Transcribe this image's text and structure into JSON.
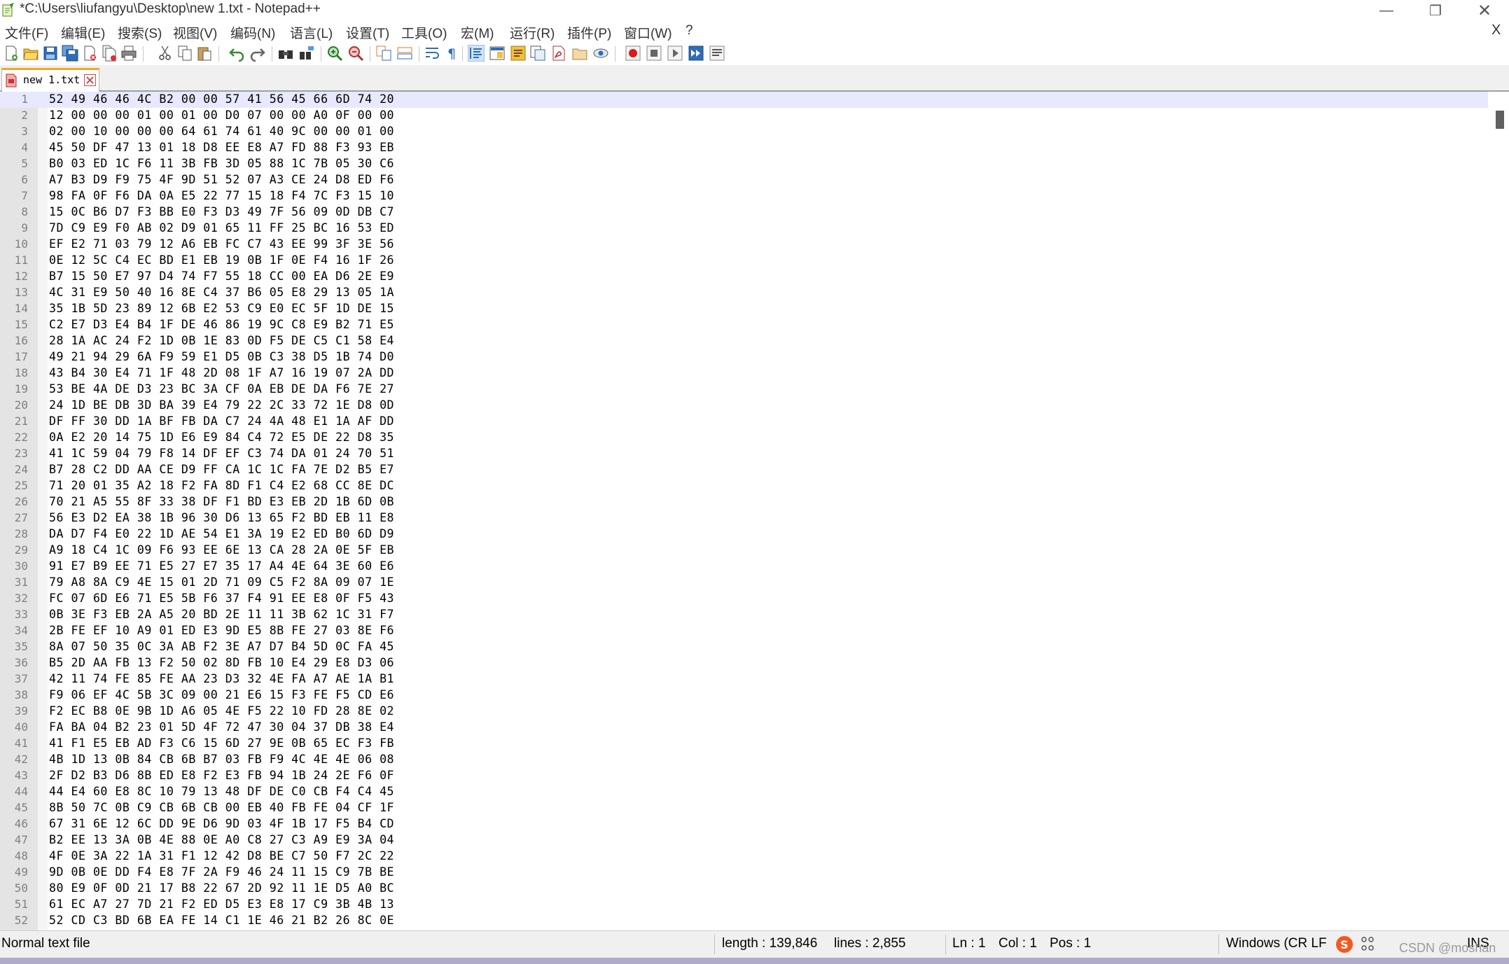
{
  "window": {
    "title": "*C:\\Users\\liufangyu\\Desktop\\new 1.txt - Notepad++",
    "minimize_glyph": "—",
    "maximize_glyph": "❐",
    "close_glyph": "✕"
  },
  "menu": {
    "items": [
      "文件(F)",
      "编辑(E)",
      "搜索(S)",
      "视图(V)",
      "编码(N)",
      "语言(L)",
      "设置(T)",
      "工具(O)",
      "宏(M)",
      "运行(R)",
      "插件(P)",
      "窗口(W)",
      "?"
    ],
    "close_label": "X"
  },
  "toolbar": {
    "icons": [
      "new-file-icon",
      "open-file-icon",
      "save-icon",
      "save-all-icon",
      "close-icon",
      "close-all-icon",
      "print-icon",
      "cut-icon",
      "copy-icon",
      "paste-icon",
      "undo-icon",
      "redo-icon",
      "find-icon",
      "replace-icon",
      "zoom-in-icon",
      "zoom-out-icon",
      "sync-vertical-icon",
      "sync-horizontal-icon",
      "word-wrap-icon",
      "show-all-chars-icon",
      "indent-guide-icon",
      "doc-map-icon",
      "function-list-icon",
      "folder-workspace-icon",
      "doc-list-icon",
      "pdf-icon",
      "folder-icon",
      "monitor-icon",
      "macro-record-icon",
      "macro-stop-icon",
      "macro-play-icon",
      "macro-run-multiple-icon",
      "macro-save-icon"
    ]
  },
  "tab": {
    "label": "new 1.txt"
  },
  "editor": {
    "current_line": 1,
    "lines": [
      "52 49 46 46 4C B2 00 00 57 41 56 45 66 6D 74 20",
      "12 00 00 00 01 00 01 00 D0 07 00 00 A0 0F 00 00",
      "02 00 10 00 00 00 64 61 74 61 40 9C 00 00 01 00",
      "45 50 DF 47 13 01 18 D8 EE E8 A7 FD 88 F3 93 EB",
      "B0 03 ED 1C F6 11 3B FB 3D 05 88 1C 7B 05 30 C6",
      "A7 B3 D9 F9 75 4F 9D 51 52 07 A3 CE 24 D8 ED F6",
      "98 FA 0F F6 DA 0A E5 22 77 15 18 F4 7C F3 15 10",
      "15 0C B6 D7 F3 BB E0 F3 D3 49 7F 56 09 0D DB C7",
      "7D C9 E9 F0 AB 02 D9 01 65 11 FF 25 BC 16 53 ED",
      "EF E2 71 03 79 12 A6 EB FC C7 43 EE 99 3F 3E 56",
      "0E 12 5C C4 EC BD E1 EB 19 0B 1F 0E F4 16 1F 26",
      "B7 15 50 E7 97 D4 74 F7 55 18 CC 00 EA D6 2E E9",
      "4C 31 E9 50 40 16 8E C4 37 B6 05 E8 29 13 05 1A",
      "35 1B 5D 23 89 12 6B E2 53 C9 E0 EC 5F 1D DE 15",
      "C2 E7 D3 E4 B4 1F DE 46 86 19 9C C8 E9 B2 71 E5",
      "28 1A AC 24 F2 1D 0B 1E 83 0D F5 DE C5 C1 58 E4",
      "49 21 94 29 6A F9 59 E1 D5 0B C3 38 D5 1B 74 D0",
      "43 B4 30 E4 71 1F 48 2D 08 1F A7 16 19 07 2A DD",
      "53 BE 4A DE D3 23 BC 3A CF 0A EB DE DA F6 7E 27",
      "24 1D BE DB 3D BA 39 E4 79 22 2C 33 72 1E D8 0D",
      "DF FF 30 DD 1A BF FB DA C7 24 4A 48 E1 1A AF DD",
      "0A E2 20 14 75 1D E6 E9 84 C4 72 E5 DE 22 D8 35",
      "41 1C 59 04 79 F8 14 DF EF C3 74 DA 01 24 70 51",
      "B7 28 C2 DD AA CE D9 FF CA 1C 1C FA 7E D2 B5 E7",
      "71 20 01 35 A2 18 F2 FA 8D F1 C4 E2 68 CC 8E DC",
      "70 21 A5 55 8F 33 38 DF F1 BD E3 EB 2D 1B 6D 0B",
      "56 E3 D2 EA 38 1B 96 30 D6 13 65 F2 BD EB 11 E8",
      "DA D7 F4 E0 22 1D AE 54 E1 3A 19 E2 ED B0 6D D9",
      "A9 18 C4 1C 09 F6 93 EE 6E 13 CA 28 2A 0E 5F EB",
      "91 E7 B9 EE 71 E5 27 E7 35 17 A4 4E 64 3E 60 E6",
      "79 A8 8A C9 4E 15 01 2D 71 09 C5 F2 8A 09 07 1E",
      "FC 07 6D E6 71 E5 5B F6 37 F4 91 EE E8 0F F5 43",
      "0B 3E F3 EB 2A A5 20 BD 2E 11 11 3B 62 1C 31 F7",
      "2B FE EF 10 A9 01 ED E3 9D E5 8B FE 27 03 8E F6",
      "8A 07 50 35 0C 3A AB F2 3E A7 D7 B4 5D 0C FA 45",
      "B5 2D AA FB 13 F2 50 02 8D FB 10 E4 29 E8 D3 06",
      "42 11 74 FE 85 FE AA 23 D3 32 4E FA A7 AE 1A B1",
      "F9 06 EF 4C 5B 3C 09 00 21 E6 15 F3 FE F5 CD E6",
      "F2 EC B8 0E 9B 1D A6 05 4E F5 22 10 FD 28 8E 02",
      "FA BA 04 B2 23 01 5D 4F 72 47 30 04 37 DB 38 E4",
      "41 F1 E5 EB AD F3 C6 15 6D 27 9E 0B 65 EC F3 FB",
      "4B 1D 13 0B 84 CB 6B B7 03 FB F9 4C 4E 4E 06 08",
      "2F D2 B3 D6 8B ED E8 F2 E3 FB 94 1B 24 2E F6 0F",
      "44 E4 60 E8 8C 10 79 13 48 DF DE C0 CB F4 C4 45",
      "8B 50 7C 0B C9 CB 6B CB 00 EB 40 FB FE 04 CF 1F",
      "67 31 6E 12 6C DD 9E D6 9D 03 4F 1B 17 F5 B4 CD",
      "B2 EE 13 3A 0B 4E 88 0E A0 C8 27 C3 A9 E9 3A 04",
      "4F 0E 3A 22 1A 31 F1 12 42 D8 BE C7 50 F7 2C 22",
      "9D 0B 0E DD F4 E8 7F 2A F9 46 24 11 15 C9 7B BE",
      "80 E9 0F 0D 21 17 B8 22 67 2D 92 11 1E D5 A0 BC",
      "61 EC A7 27 7D 21 F2 ED D5 E3 E8 17 C9 3B 4B 13",
      "52 CD C3 BD 6B EA FE 14 C1 1E 46 21 B2 26 8C 0E"
    ]
  },
  "status": {
    "file_type": "Normal text file",
    "length": "length : 139,846",
    "lines": "lines : 2,855",
    "ln": "Ln : 1",
    "col": "Col : 1",
    "pos": "Pos : 1",
    "eol": "Windows (CR LF",
    "ins": "INS",
    "watermark": "CSDN @moshan"
  },
  "colors": {
    "current_line": "#e8e8ff",
    "tab_accent": "#f5a623",
    "gutter": "#e4e4e4"
  }
}
